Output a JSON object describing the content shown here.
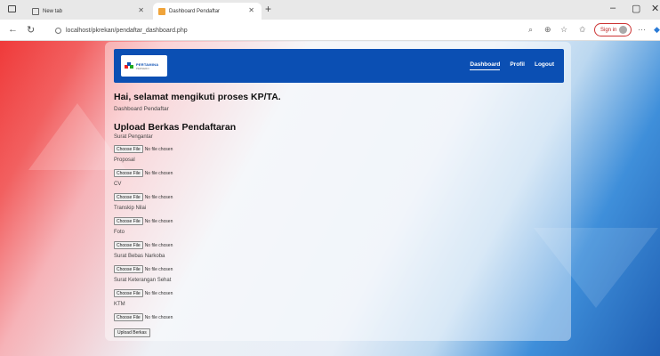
{
  "browser": {
    "tabs": [
      {
        "title": "New tab",
        "active": false
      },
      {
        "title": "Dashboard Pendaftar",
        "active": true
      }
    ],
    "new_tab_symbol": "+",
    "url": "localhost/pkrekan/pendaftar_dashboard.php",
    "sign_in_label": "Sign in",
    "icons": [
      "back-icon",
      "reload-icon",
      "search-icon",
      "zoom-icon",
      "favorite-icon",
      "favorites-bar-icon",
      "more-icon",
      "copilot-icon"
    ]
  },
  "navbar": {
    "logo_text": "PERTAMINA",
    "logo_subtext": "PERSERO",
    "links": [
      "Dashboard",
      "Profil",
      "Logout"
    ],
    "active_link": "Dashboard"
  },
  "main": {
    "greeting": "Hai, selamat mengikuti proses KP/TA.",
    "subtitle": "Dashboard Pendaftar",
    "upload_title": "Upload Berkas Pendaftaran",
    "fields": [
      {
        "label": "Surat Pengantar"
      },
      {
        "label": "Proposal"
      },
      {
        "label": "CV"
      },
      {
        "label": "Transkip Nilai"
      },
      {
        "label": "Foto"
      },
      {
        "label": "Surat Bebas Narkoba"
      },
      {
        "label": "Surat Keterangan Sehat"
      },
      {
        "label": "KTM"
      }
    ],
    "choose_file_label": "Choose File",
    "no_file_text": "No file chosen",
    "submit_label": "Upload Berkas"
  },
  "colors": {
    "navbar": "#0b4fb3",
    "bg_red": "#ef3a3a",
    "bg_blue": "#1f5fb3"
  }
}
